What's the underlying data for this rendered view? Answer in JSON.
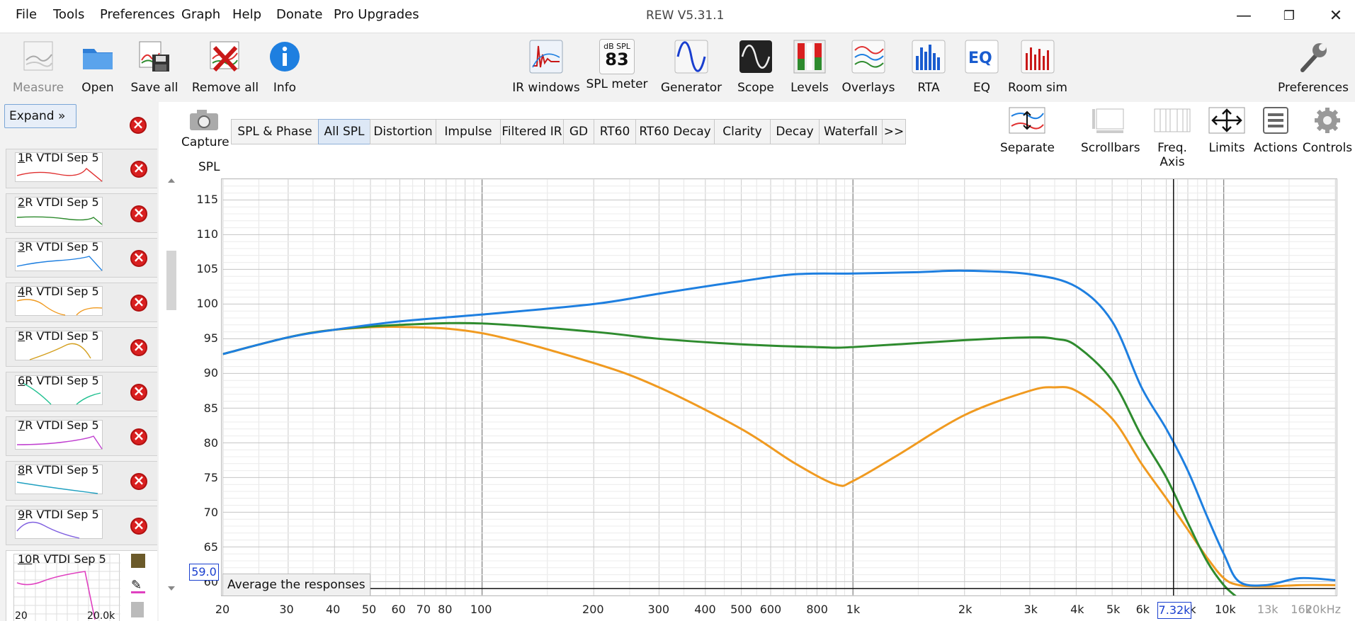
{
  "window": {
    "title": "REW V5.31.1",
    "menu": [
      "File",
      "Tools",
      "Preferences",
      "Graph",
      "Help",
      "Donate",
      "Pro Upgrades"
    ]
  },
  "toolbar": {
    "left": [
      {
        "label": "Measure",
        "icon": "measure-icon",
        "disabled": true
      },
      {
        "label": "Open",
        "icon": "folder-icon"
      },
      {
        "label": "Save all",
        "icon": "save-all-icon"
      },
      {
        "label": "Remove all",
        "icon": "remove-all-icon"
      },
      {
        "label": "Info",
        "icon": "info-icon"
      }
    ],
    "center": [
      {
        "label": "IR windows",
        "icon": "ir-windows-icon"
      },
      {
        "label": "SPL meter",
        "icon": "spl-meter-icon",
        "badge_top": "dB SPL",
        "badge_value": "83"
      },
      {
        "label": "Generator",
        "icon": "generator-icon"
      },
      {
        "label": "Scope",
        "icon": "scope-icon"
      },
      {
        "label": "Levels",
        "icon": "levels-icon"
      },
      {
        "label": "Overlays",
        "icon": "overlays-icon"
      },
      {
        "label": "RTA",
        "icon": "rta-icon"
      },
      {
        "label": "EQ",
        "icon": "eq-icon"
      },
      {
        "label": "Room sim",
        "icon": "room-sim-icon"
      }
    ],
    "right": {
      "label": "Preferences",
      "icon": "wrench-icon"
    }
  },
  "left_panel": {
    "expand_label": "Expand",
    "measurements": [
      {
        "num": "1",
        "name": "R VTDI Sep 5",
        "color": "#e03030"
      },
      {
        "num": "2",
        "name": "R VTDI Sep 5",
        "color": "#2e8b2e"
      },
      {
        "num": "3",
        "name": "R VTDI Sep 5",
        "color": "#1e7fe0"
      },
      {
        "num": "4",
        "name": "R VTDI Sep 5",
        "color": "#f09a20"
      },
      {
        "num": "5",
        "name": "R VTDI Sep 5",
        "color": "#d4a020"
      },
      {
        "num": "6",
        "name": "R VTDI Sep 5",
        "color": "#20c090"
      },
      {
        "num": "7",
        "name": "R VTDI Sep 5",
        "color": "#c040d0"
      },
      {
        "num": "8",
        "name": "R VTDI Sep 5",
        "color": "#20a0c0"
      },
      {
        "num": "9",
        "name": "R VTDI Sep 5",
        "color": "#8060e0"
      },
      {
        "num": "10",
        "name": "R VTDI Sep 5",
        "color": "#e040c0",
        "selected": true,
        "thumb_left": "20",
        "thumb_right": "20.0k"
      }
    ]
  },
  "capture_label": "Capture",
  "graph_tabs": [
    {
      "label": "SPL & Phase"
    },
    {
      "label": "All SPL",
      "active": true
    },
    {
      "label": "Distortion"
    },
    {
      "label": "Impulse"
    },
    {
      "label": "Filtered IR"
    },
    {
      "label": "GD"
    },
    {
      "label": "RT60"
    },
    {
      "label": "RT60 Decay"
    },
    {
      "label": "Clarity"
    },
    {
      "label": "Decay"
    },
    {
      "label": "Waterfall"
    },
    {
      "label": ">>"
    }
  ],
  "graph_controls": [
    {
      "label": "Separate",
      "icon": "separate-icon"
    },
    {
      "label": "Scrollbars",
      "icon": "scrollbars-icon"
    },
    {
      "label": "Freq. Axis",
      "icon": "freq-axis-icon"
    },
    {
      "label": "Limits",
      "icon": "limits-icon"
    },
    {
      "label": "Actions",
      "icon": "actions-icon"
    },
    {
      "label": "Controls",
      "icon": "gear-icon"
    }
  ],
  "average_button": "Average the responses",
  "cursor": {
    "y_readout": "59.0",
    "x_readout": "7.32k"
  },
  "chart_data": {
    "type": "line",
    "ylabel": "SPL",
    "xlabel": "",
    "x_scale": "log",
    "xlim": [
      20,
      20000
    ],
    "ylim": [
      58,
      118
    ],
    "y_ticks": [
      115,
      110,
      105,
      100,
      95,
      90,
      85,
      80,
      75,
      70,
      65,
      60
    ],
    "x_ticks": [
      {
        "v": 20,
        "t": "20"
      },
      {
        "v": 30,
        "t": "30"
      },
      {
        "v": 40,
        "t": "40"
      },
      {
        "v": 50,
        "t": "50"
      },
      {
        "v": 60,
        "t": "60"
      },
      {
        "v": 70,
        "t": "70"
      },
      {
        "v": 80,
        "t": "80"
      },
      {
        "v": 100,
        "t": "100"
      },
      {
        "v": 200,
        "t": "200"
      },
      {
        "v": 300,
        "t": "300"
      },
      {
        "v": 400,
        "t": "400"
      },
      {
        "v": 500,
        "t": "500"
      },
      {
        "v": 600,
        "t": "600"
      },
      {
        "v": 800,
        "t": "800"
      },
      {
        "v": 1000,
        "t": "1k"
      },
      {
        "v": 2000,
        "t": "2k"
      },
      {
        "v": 3000,
        "t": "3k"
      },
      {
        "v": 4000,
        "t": "4k"
      },
      {
        "v": 5000,
        "t": "5k"
      },
      {
        "v": 6000,
        "t": "6k"
      },
      {
        "v": 8000,
        "t": "8k"
      },
      {
        "v": 10000,
        "t": "10k"
      },
      {
        "v": 13000,
        "t": "13k"
      },
      {
        "v": 16000,
        "t": "16k"
      },
      {
        "v": 20000,
        "t": "20kHz"
      }
    ],
    "cursor_x": 7320,
    "cursor_y": 59.0,
    "series": [
      {
        "color": "#1e7fe0",
        "x": [
          20,
          30,
          40,
          60,
          100,
          200,
          300,
          500,
          700,
          1000,
          1500,
          2000,
          3000,
          4000,
          5000,
          6000,
          7000,
          8000,
          9000,
          10000,
          11000,
          13000,
          16000,
          20000
        ],
        "y": [
          92.8,
          95.2,
          96.3,
          97.5,
          98.5,
          100.0,
          101.5,
          103.3,
          104.3,
          104.4,
          104.6,
          104.8,
          104.3,
          102.5,
          97.5,
          88.0,
          82.0,
          76.0,
          69.5,
          64.0,
          60.0,
          59.5,
          60.5,
          60.2
        ]
      },
      {
        "color": "#2e8b2e",
        "x": [
          20,
          30,
          40,
          60,
          100,
          200,
          300,
          500,
          800,
          1000,
          2000,
          3000,
          3500,
          4000,
          5000,
          6000,
          7000,
          8000,
          9000,
          10000,
          11000
        ],
        "y": [
          92.8,
          95.2,
          96.3,
          97.0,
          97.2,
          96.0,
          95.0,
          94.2,
          93.8,
          93.8,
          94.8,
          95.2,
          95.0,
          94.0,
          89.0,
          81.0,
          75.0,
          68.5,
          63.0,
          59.5,
          57.5
        ]
      },
      {
        "color": "#f09a20",
        "x": [
          20,
          30,
          40,
          60,
          100,
          200,
          300,
          500,
          700,
          900,
          1000,
          1300,
          2000,
          3000,
          3500,
          4000,
          5000,
          6000,
          7000,
          8000,
          9000,
          10000,
          11000,
          13000,
          16000,
          20000
        ],
        "y": [
          92.8,
          95.2,
          96.3,
          96.7,
          95.8,
          91.5,
          88.0,
          82.0,
          77.0,
          74.0,
          74.5,
          78.0,
          84.0,
          87.5,
          88.0,
          87.5,
          83.5,
          77.0,
          72.0,
          67.5,
          63.5,
          60.5,
          59.5,
          59.3,
          59.5,
          59.5
        ]
      }
    ]
  }
}
